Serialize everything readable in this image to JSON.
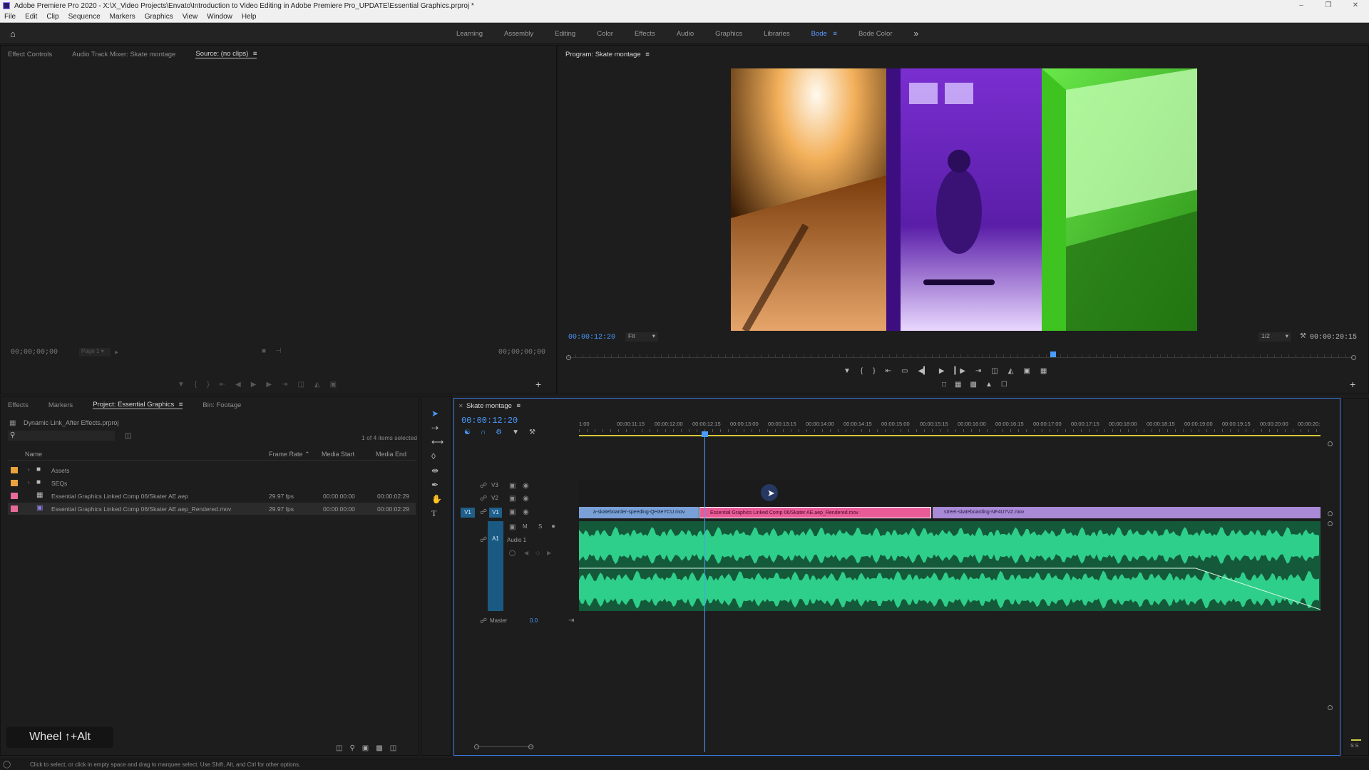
{
  "window": {
    "title": "Adobe Premiere Pro 2020 - X:\\X_Video Projects\\Envato\\Introduction to Video Editing in Adobe Premiere Pro_UPDATE\\Essential Graphics.prproj *"
  },
  "menu": [
    "File",
    "Edit",
    "Clip",
    "Sequence",
    "Markers",
    "Graphics",
    "View",
    "Window",
    "Help"
  ],
  "workspaces": [
    "Learning",
    "Assembly",
    "Editing",
    "Color",
    "Effects",
    "Audio",
    "Graphics",
    "Libraries",
    "Bode",
    "Bode Color"
  ],
  "workspace_active": "Bode",
  "workspace_more": "»",
  "source_panel": {
    "tabs": [
      "Effect Controls",
      "Audio Track Mixer: Skate montage",
      "Source: (no clips)"
    ],
    "active_tab": "Source: (no clips)",
    "timecode_left": "00;00;00;00",
    "page": "Page 1",
    "timecode_right": "00;00;00;00"
  },
  "program_panel": {
    "tab": "Program: Skate montage",
    "timecode": "00:00:12:20",
    "fit": "Fit",
    "resolution": "1/2",
    "duration": "00:00:20:15",
    "playhead_fraction": 0.618
  },
  "project_panel": {
    "tabs": [
      "Effects",
      "Markers",
      "Project: Essential Graphics",
      "Bin: Footage"
    ],
    "active_tab": "Project: Essential Graphics",
    "path": "Dynamic Link_After Effects.prproj",
    "selection": "1 of 4 items selected",
    "columns": [
      "Name",
      "Frame Rate",
      "Media Start",
      "Media End"
    ],
    "rows": [
      {
        "color": "#e8a33c",
        "type": "folder",
        "name": "Assets",
        "fps": "",
        "start": "",
        "end": ""
      },
      {
        "color": "#e8a33c",
        "type": "folder",
        "name": "SEQs",
        "fps": "",
        "start": "",
        "end": ""
      },
      {
        "color": "#e66b9a",
        "type": "comp",
        "name": "Essential Graphics Linked Comp 06/Skater AE.aep",
        "fps": "29.97 fps",
        "start": "00:00:00:00",
        "end": "00:00:02:29"
      },
      {
        "color": "#e66b9a",
        "type": "movie",
        "name": "Essential Graphics Linked Comp 06/Skater AE.aep_Rendered.mov",
        "fps": "29.97 fps",
        "start": "00:00:00:00",
        "end": "00:00:02:29"
      }
    ]
  },
  "overlay_hint": "Wheel ↑+Alt",
  "timeline": {
    "tab": "Skate montage",
    "timecode": "00:00:12:20",
    "ruler": [
      "1:00",
      "00:00:11:15",
      "00:00:12:00",
      "00:00:12:15",
      "00:00:13:00",
      "00:00:13:15",
      "00:00:14:00",
      "00:00:14:15",
      "00:00:15:00",
      "00:00:15:15",
      "00:00:16:00",
      "00:00:16:15",
      "00:00:17:00",
      "00:00:17:15",
      "00:00:18:00",
      "00:00:18:15",
      "00:00:19:00",
      "00:00:19:15",
      "00:00:20:00",
      "00:00:20:"
    ],
    "tracks": {
      "v3": "V3",
      "v2": "V2",
      "v1": "V1",
      "v1_src": "V1",
      "a1": "A1",
      "a1_name": "Audio 1",
      "master": "Master",
      "master_value": "0.0",
      "m": "M",
      "s": "S"
    },
    "clips": [
      {
        "name": "a-skateboarder-speeding-QH3eYCU.mov",
        "color": "#7aa0d8"
      },
      {
        "name": "Essential Graphics Linked Comp 06/Skater AE.aep_Rendered.mov",
        "color": "#e85b97"
      },
      {
        "name": "street-skateboarding-NF4U7VZ.mov",
        "color": "#a98ad6"
      }
    ]
  },
  "status_bar": "Click to select, or click in empty space and drag to marquee select. Use Shift, Alt, and Ctrl for other options.",
  "colors": {
    "accent": "#4a9bff",
    "audio": "#2ecf8a"
  }
}
